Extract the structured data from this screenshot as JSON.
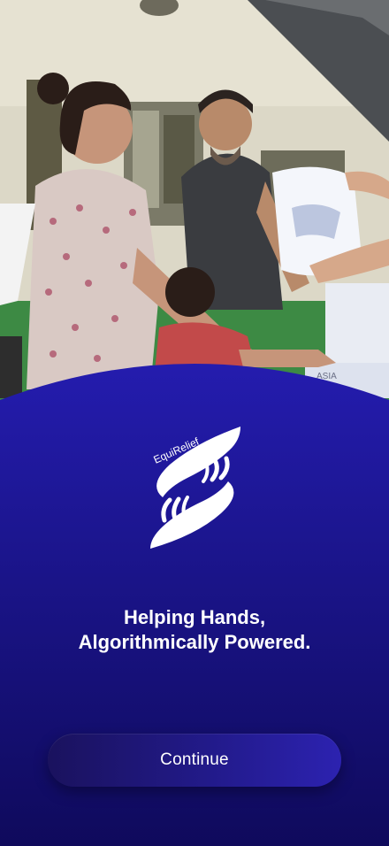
{
  "hero": {
    "photo_description_icon": "volunteers-distributing-relief-photo",
    "bag_text": "ASIA"
  },
  "logo": {
    "icon": "caring-hands-icon",
    "brand": "EquiRelief"
  },
  "tagline": {
    "line1": "Helping Hands,",
    "line2": "Algorithmically Powered."
  },
  "continue": {
    "label": "Continue"
  },
  "colors": {
    "panel_top": "#241cae",
    "panel_bottom": "#0f0a5c",
    "button_start": "#1a125e",
    "button_end": "#2c22b0",
    "text": "#ffffff"
  }
}
